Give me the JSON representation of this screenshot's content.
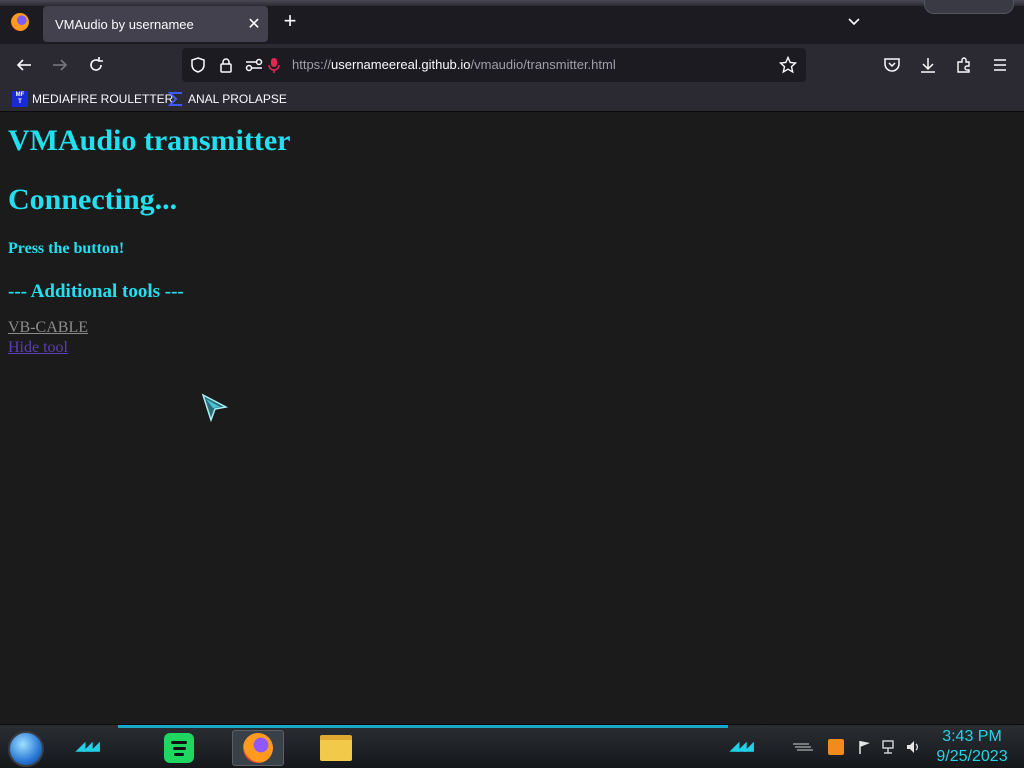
{
  "browser": {
    "tab": {
      "title": "VMAudio by usernamee",
      "close": "✕"
    },
    "new_tab": "+",
    "url": {
      "scheme": "https://",
      "host": "usernameereal.github.io",
      "path": "/vmaudio/transmitter.html"
    },
    "bookmarks": [
      {
        "label": "MEDIAFIRE ROULETTER",
        "icon_text": "MF\nT"
      },
      {
        "label": "ANAL PROLAPSE"
      }
    ]
  },
  "page": {
    "title": "VMAudio transmitter",
    "status": "Connecting...",
    "instruction": "Press the button!",
    "tools_heading": "--- Additional tools ---",
    "links": [
      "VB-CABLE",
      "Hide tool"
    ]
  },
  "taskbar": {
    "time": "3:43 PM",
    "date": "9/25/2023",
    "chevrons": "◢◢◢"
  },
  "colors": {
    "accent": "#22e0f0",
    "page_bg": "#1c1b1c",
    "chrome_bg": "#2b2a33"
  }
}
